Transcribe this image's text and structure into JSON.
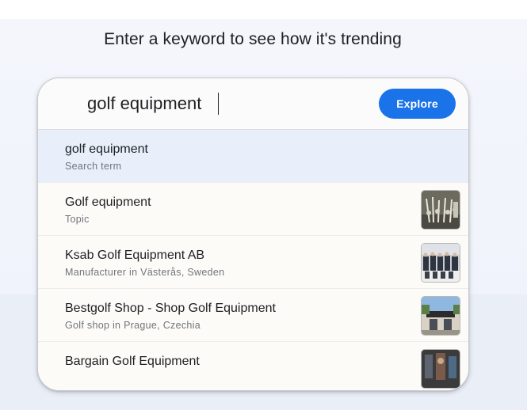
{
  "page": {
    "headline": "Enter a keyword to see how it's trending"
  },
  "search": {
    "value": "golf equipment",
    "explore_label": "Explore"
  },
  "suggestions": [
    {
      "title": "golf equipment",
      "subtitle": "Search term",
      "thumbnail": "none",
      "selected": true
    },
    {
      "title": "Golf equipment",
      "subtitle": "Topic",
      "thumbnail": "golf-clubs-photo",
      "selected": false
    },
    {
      "title": "Ksab Golf Equipment AB",
      "subtitle": "Manufacturer in Västerås, Sweden",
      "thumbnail": "group-photo",
      "selected": false
    },
    {
      "title": "Bestgolf Shop - Shop Golf Equipment",
      "subtitle": "Golf shop in Prague, Czechia",
      "thumbnail": "storefront-photo",
      "selected": false
    },
    {
      "title": "Bargain Golf Equipment",
      "subtitle": "",
      "thumbnail": "store-interior-photo",
      "selected": false
    }
  ],
  "colors": {
    "accent": "#1a73e8",
    "selected_row": "#e8effb",
    "text_primary": "#202124",
    "text_secondary": "#70757a"
  }
}
